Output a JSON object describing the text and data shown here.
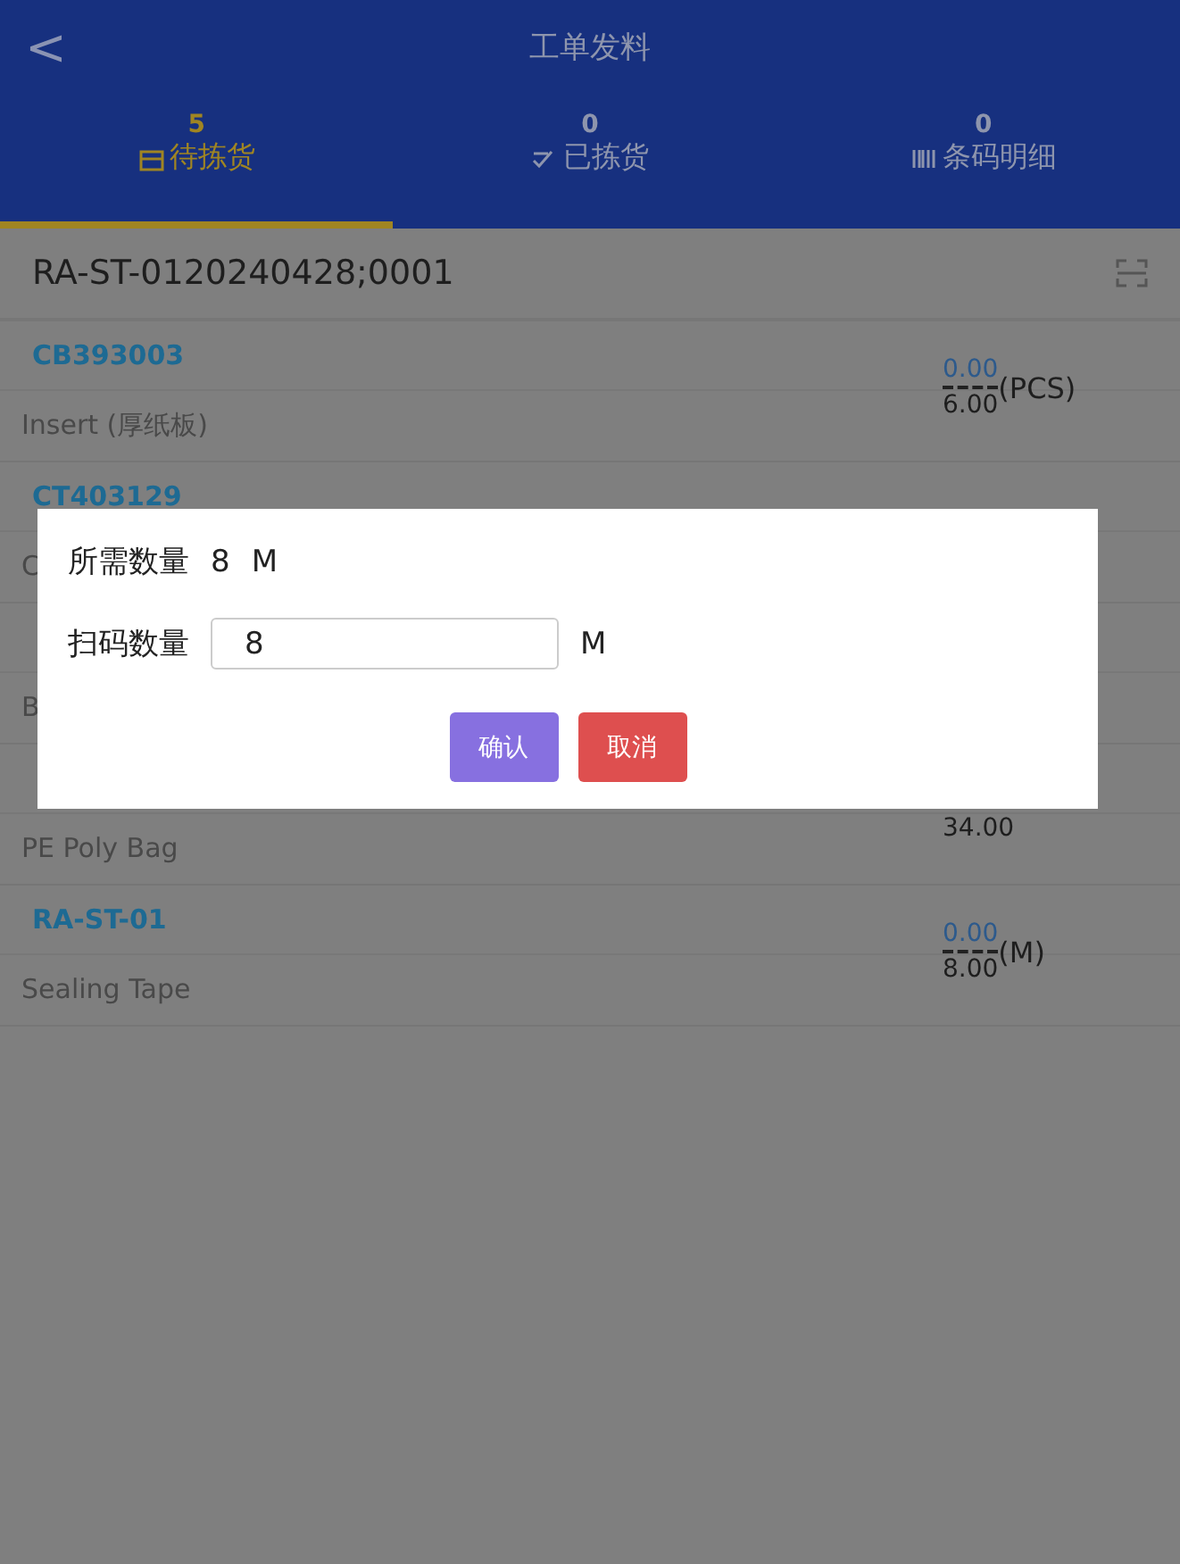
{
  "header": {
    "title": "工单发料",
    "back": "<"
  },
  "tabs": [
    {
      "count": "5",
      "label": "待拣货",
      "selected": true
    },
    {
      "count": "0",
      "label": "已拣货",
      "selected": false
    },
    {
      "count": "0",
      "label": "条码明细",
      "selected": false
    }
  ],
  "scan": {
    "value": "RA-ST-0120240428;0001"
  },
  "items": [
    {
      "code": "CB393003",
      "name": "Insert (厚纸板)",
      "picked": "0.00",
      "required": "6.00",
      "unit": "(PCS)"
    },
    {
      "code": "CT403129",
      "name": "C"
    },
    {
      "name": "B"
    },
    {
      "name": "PE Poly Bag",
      "required": "34.00"
    },
    {
      "code": "RA-ST-01",
      "name": "Sealing Tape",
      "picked": "0.00",
      "required": "8.00",
      "unit": "(M)"
    }
  ],
  "dialog": {
    "required_label": "所需数量",
    "required_value": "8",
    "required_unit": "M",
    "scan_label": "扫码数量",
    "scan_value": "8",
    "scan_unit": "M",
    "confirm": "确认",
    "cancel": "取消"
  }
}
